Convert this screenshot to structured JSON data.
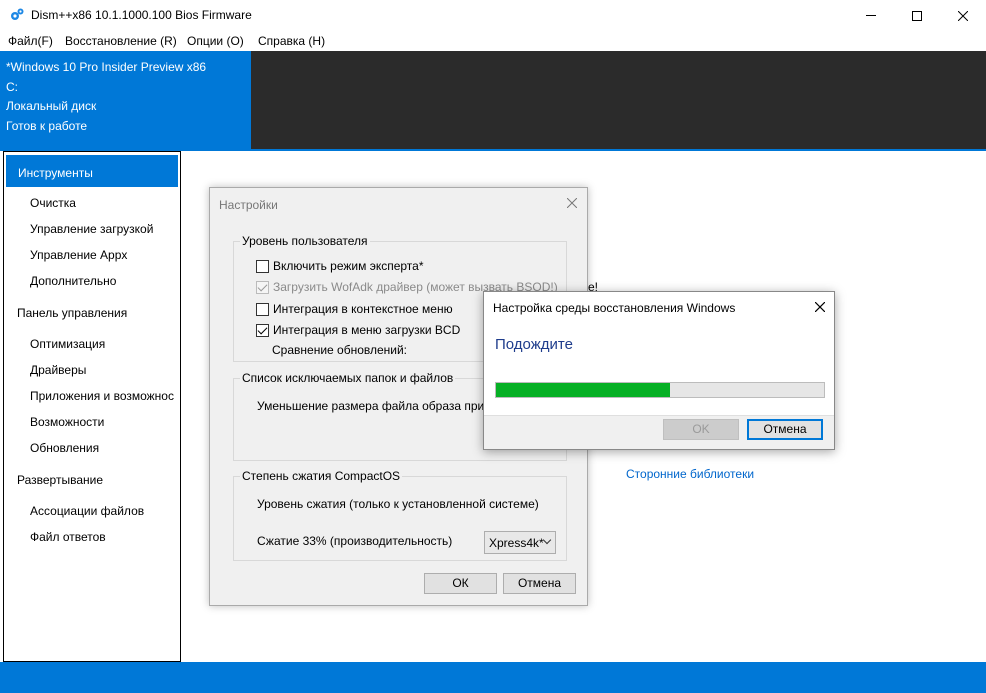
{
  "window": {
    "title": "Dism++x86 10.1.1000.100 Bios Firmware",
    "icon": "gears-icon"
  },
  "menu": [
    "Файл(F)",
    "Восстановление (R)",
    "Опции (O)",
    "Справка (H)"
  ],
  "info": {
    "os": "*Windows 10 Pro Insider Preview x86",
    "drive": "C:",
    "disk": "Локальный диск",
    "status": "Готов к работе"
  },
  "sidebar": {
    "selected": "Инструменты",
    "tools": [
      "Очистка",
      "Управление загрузкой",
      "Управление Appx",
      "Дополнительно"
    ],
    "control_panel": "Панель управления",
    "control_items": [
      "Оптимизация",
      "Драйверы",
      "Приложения и возможнос",
      "Возможности",
      "Обновления"
    ],
    "deployment": "Развертывание",
    "deployment_items": [
      "Ассоциации файлов",
      "Файл ответов"
    ]
  },
  "background": {
    "link": "Сторонние библиотеки",
    "partial_text": "е!"
  },
  "settings": {
    "title": "Настройки",
    "group_user": "Уровень пользователя",
    "cb_expert": "Включить режим эксперта*",
    "cb_wofadk": "Загрузить WofAdk драйвер (может вызвать BSOD!)",
    "cb_context": "Интеграция в контекстное меню",
    "cb_bcd": "Интеграция в меню загрузки BCD",
    "compare_updates": "Сравнение обновлений:",
    "group_exclude": "Список исключаемых папок и файлов",
    "reduce_size": "Уменьшение размера файла образа при сохр",
    "group_compact": "Степень сжатия CompactOS",
    "compress_level": "Уровень сжатия (только к установленной системе)",
    "compress_33": "Сжатие 33% (производительность)",
    "compress_select": "Xpress4k*",
    "ok": "ОК",
    "cancel": "Отмена"
  },
  "progress": {
    "title": "Настройка среды восстановления Windows",
    "heading": "Подождите",
    "percent": 0.53,
    "ok": "OK",
    "cancel": "Отмена"
  },
  "colors": {
    "accent": "#0078d7",
    "progress_fill": "#06b025",
    "heading": "#1e3c8c"
  }
}
